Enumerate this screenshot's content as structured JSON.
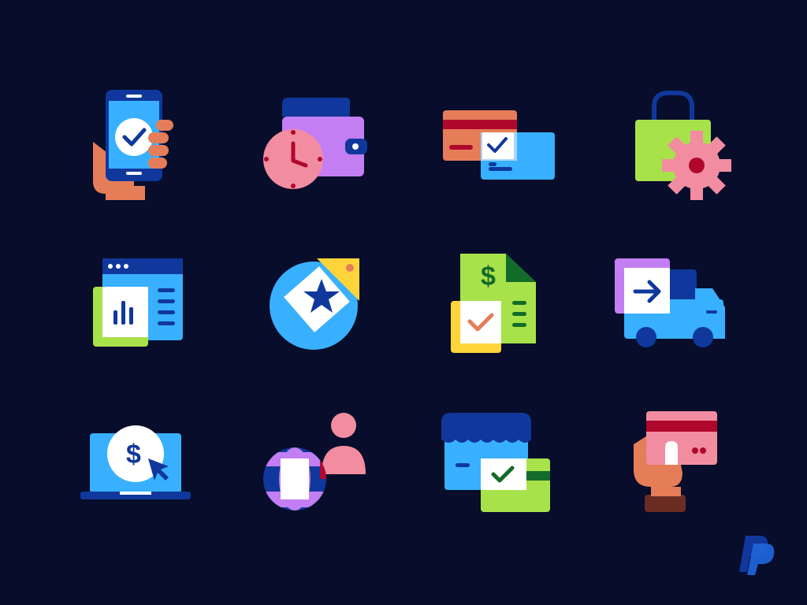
{
  "colors": {
    "background": "#070d2a",
    "navy": "#10389c",
    "blue": "#38b0ff",
    "purple": "#c27ef2",
    "green": "#a8e24a",
    "pink": "#f28ca0",
    "yellow": "#ffd43a",
    "salmon": "#e57d58",
    "red": "#b0082d",
    "white": "#ffffff"
  },
  "icons": [
    {
      "name": "phone-payment-confirmed-icon",
      "row": 1,
      "col": 1
    },
    {
      "name": "wallet-clock-icon",
      "row": 1,
      "col": 2
    },
    {
      "name": "credit-card-verified-icon",
      "row": 1,
      "col": 3
    },
    {
      "name": "shopping-bag-settings-icon",
      "row": 1,
      "col": 4
    },
    {
      "name": "dashboard-analytics-icon",
      "row": 2,
      "col": 1
    },
    {
      "name": "loyalty-tag-star-icon",
      "row": 2,
      "col": 2
    },
    {
      "name": "invoice-approved-icon",
      "row": 2,
      "col": 3
    },
    {
      "name": "delivery-truck-icon",
      "row": 2,
      "col": 4
    },
    {
      "name": "laptop-payment-click-icon",
      "row": 3,
      "col": 1
    },
    {
      "name": "global-user-icon",
      "row": 3,
      "col": 2
    },
    {
      "name": "store-payment-verified-icon",
      "row": 3,
      "col": 3
    },
    {
      "name": "hand-holding-card-icon",
      "row": 3,
      "col": 4
    }
  ],
  "brand": {
    "logo": "paypal-logo-icon"
  }
}
